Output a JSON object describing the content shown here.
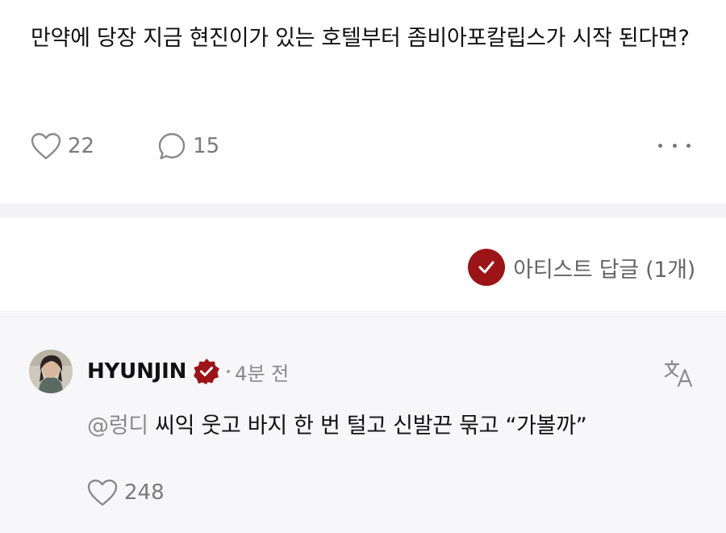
{
  "post": {
    "text": "만약에 당장 지금 현진이가 있는 호텔부터 좀비아포칼립스가 시작 된다면?",
    "like_count": "22",
    "comment_count": "15"
  },
  "artist_reply": {
    "label": "아티스트 답글 (1개)",
    "badge_color": "#9b1418"
  },
  "comment": {
    "author": "HYUNJIN",
    "time": "4분 전",
    "mention": "@렁디",
    "text": "씨익 웃고 바지 한 번 털고 신발끈 묶고 “가볼까”",
    "like_count": "248"
  },
  "icons": {
    "like": "heart-icon",
    "comment": "speech-bubble-icon",
    "more": "more-dots-icon",
    "check": "check-icon",
    "verified": "verified-badge-icon",
    "translate": "translate-icon"
  }
}
